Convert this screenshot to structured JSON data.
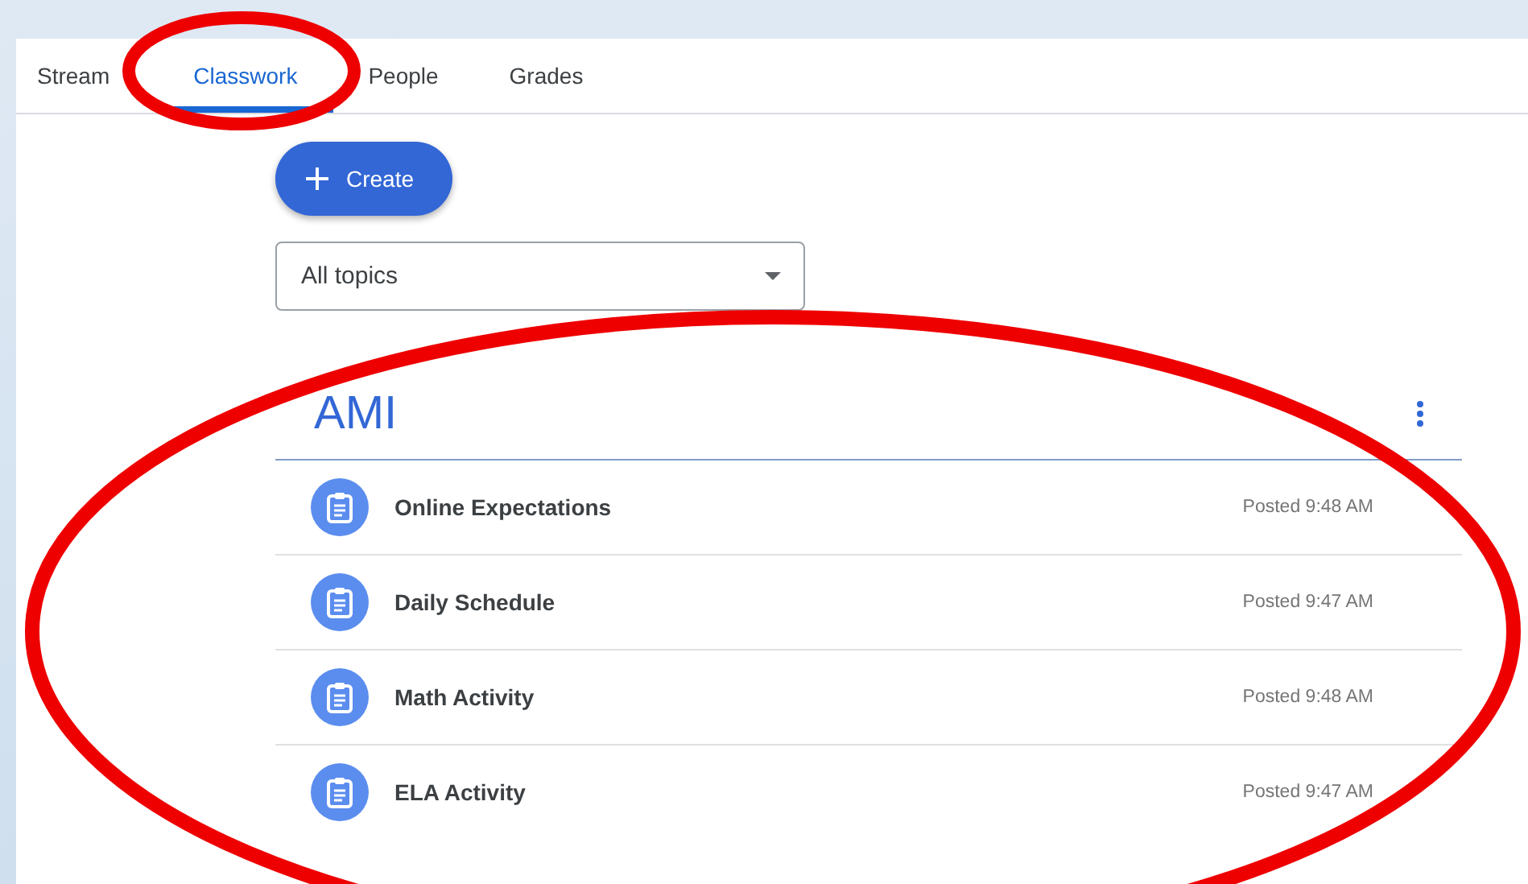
{
  "tabs": [
    {
      "label": "Stream",
      "selected": false
    },
    {
      "label": "Classwork",
      "selected": true
    },
    {
      "label": "People",
      "selected": false
    },
    {
      "label": "Grades",
      "selected": false
    }
  ],
  "create_button": {
    "label": "Create"
  },
  "topic_filter": {
    "value": "All topics"
  },
  "topic": {
    "title": "AMI",
    "items": [
      {
        "title": "Online Expectations",
        "posted": "Posted 9:48 AM"
      },
      {
        "title": "Daily Schedule",
        "posted": "Posted 9:47 AM"
      },
      {
        "title": "Math Activity",
        "posted": "Posted 9:48 AM"
      },
      {
        "title": "ELA Activity",
        "posted": "Posted 9:47 AM"
      }
    ]
  }
}
